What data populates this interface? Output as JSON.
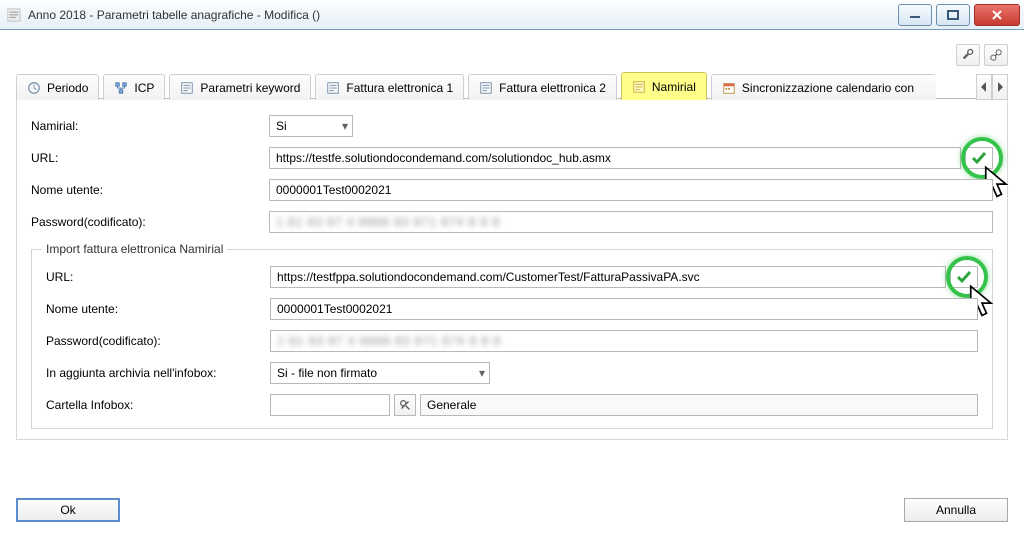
{
  "window": {
    "title": "Anno 2018 - Parametri tabelle anagrafiche - Modifica ()"
  },
  "tabs": [
    {
      "label": "Periodo"
    },
    {
      "label": "ICP"
    },
    {
      "label": "Parametri keyword"
    },
    {
      "label": "Fattura elettronica 1"
    },
    {
      "label": "Fattura elettronica 2"
    },
    {
      "label": "Namirial",
      "active": true
    },
    {
      "label": "Sincronizzazione calendario con"
    }
  ],
  "main": {
    "namirial_label": "Namirial:",
    "namirial_value": "Si",
    "url_label": "URL:",
    "url_value": "https://testfe.solutiondocondemand.com/solutiondoc_hub.asmx",
    "user_label": "Nome utente:",
    "user_value": "0000001Test0002021",
    "pw_label": "Password(codificato):",
    "pw_value": "1 81 83 87 4 8888 83 871 874 8 8 8"
  },
  "import": {
    "group_title": "Import fattura elettronica Namirial",
    "url_label": "URL:",
    "url_value": "https://testfppa.solutiondocondemand.com/CustomerTest/FatturaPassivaPA.svc",
    "user_label": "Nome utente:",
    "user_value": "0000001Test0002021",
    "pw_label": "Password(codificato):",
    "pw_value": "1 81 83 87 4 8888 83 871 874 8 8 8",
    "archive_label": "In aggiunta archivia nell'infobox:",
    "archive_value": "Si - file non firmato",
    "folder_label": "Cartella Infobox:",
    "folder_code": "",
    "folder_name": "Generale"
  },
  "footer": {
    "ok_label": "Ok",
    "cancel_label": "Annulla"
  }
}
